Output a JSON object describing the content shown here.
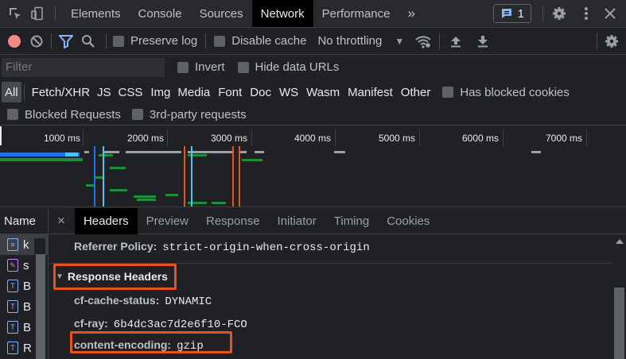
{
  "toolbar": {
    "tabs": [
      "Elements",
      "Console",
      "Sources",
      "Network",
      "Performance"
    ],
    "more": "»",
    "issues_count": "1"
  },
  "network_toolbar": {
    "preserve_log": "Preserve log",
    "disable_cache": "Disable cache",
    "throttling": "No throttling"
  },
  "filter_bar": {
    "placeholder": "Filter",
    "invert": "Invert",
    "hide_data_urls": "Hide data URLs"
  },
  "types": [
    "All",
    "Fetch/XHR",
    "JS",
    "CSS",
    "Img",
    "Media",
    "Font",
    "Doc",
    "WS",
    "Wasm",
    "Manifest",
    "Other"
  ],
  "has_blocked_cookies": "Has blocked cookies",
  "blocked_requests": "Blocked Requests",
  "third_party": "3rd-party requests",
  "timeline": {
    "ticks": [
      "1000 ms",
      "2000 ms",
      "3000 ms",
      "4000 ms",
      "5000 ms",
      "6000 ms",
      "7000 ms"
    ]
  },
  "name_column": {
    "header": "Name",
    "rows": [
      {
        "icon": "document-icon",
        "text": "k"
      },
      {
        "icon": "script-icon",
        "text": "s"
      },
      {
        "icon": "text-icon",
        "text": "B"
      },
      {
        "icon": "text-icon",
        "text": "B"
      },
      {
        "icon": "text-icon",
        "text": "B"
      },
      {
        "icon": "text-icon",
        "text": "R"
      }
    ]
  },
  "detail_tabs": {
    "close": "×",
    "tabs": [
      "Headers",
      "Preview",
      "Response",
      "Initiator",
      "Timing",
      "Cookies"
    ]
  },
  "headers": {
    "referrer_key": "Referrer Policy:",
    "referrer_value": "strict-origin-when-cross-origin",
    "section_title": "Response Headers",
    "rows": [
      {
        "key": "cf-cache-status:",
        "value": "DYNAMIC"
      },
      {
        "key": "cf-ray:",
        "value": "6b4dc3ac7d2e6f10-FCO"
      },
      {
        "key": "content-encoding:",
        "value": "gzip"
      }
    ]
  },
  "colors": {
    "highlight": "#e8531a",
    "accent": "#8ab4f8",
    "record": "#f28b82"
  }
}
